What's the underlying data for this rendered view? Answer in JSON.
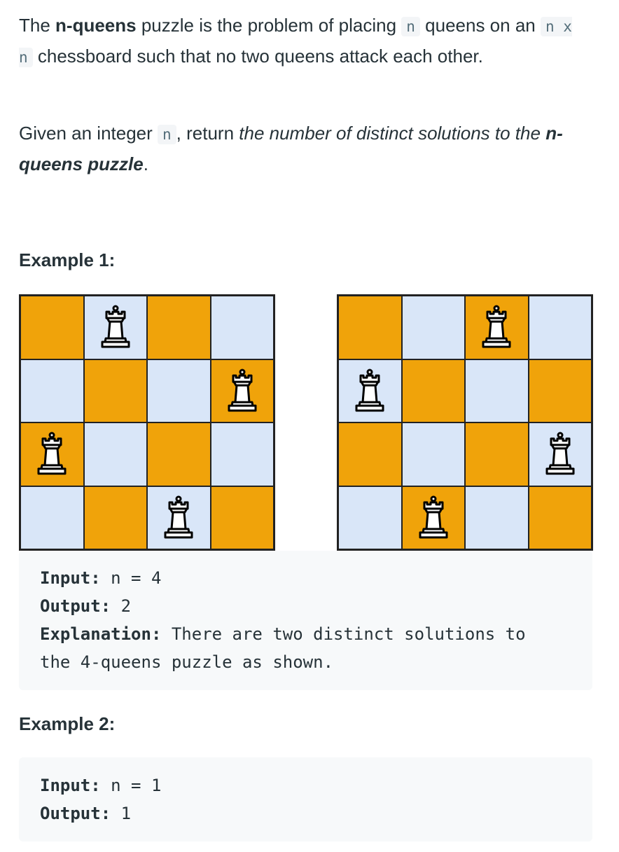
{
  "intro": {
    "t1": "The ",
    "b1": "n-queens",
    "t2": " puzzle is the problem of placing ",
    "c1": "n",
    "t3": " queens on an ",
    "c2": "n x n",
    "t4": " chessboard such that no two queens attack each other."
  },
  "task": {
    "t1": "Given an integer ",
    "c1": "n",
    "t2": ", return ",
    "i1": "the number of distinct solutions to the ",
    "bi1": "n-queens puzzle",
    "t3": "."
  },
  "example1": {
    "heading": "Example 1:",
    "boards": [
      {
        "queens": [
          1,
          3,
          0,
          2
        ]
      },
      {
        "queens": [
          2,
          0,
          3,
          1
        ]
      }
    ],
    "input_label": "Input:",
    "input_value": " n = 4",
    "output_label": "Output:",
    "output_value": " 2",
    "explanation_label": "Explanation:",
    "explanation_line1": " There are two distinct solutions to",
    "explanation_line2": "the 4-queens puzzle as shown."
  },
  "example2": {
    "heading": "Example 2:",
    "input_label": "Input:",
    "input_value": " n = 1",
    "output_label": "Output:",
    "output_value": " 1"
  },
  "colors": {
    "dark_square": "#f0a30a",
    "light_square": "#d9e6f8"
  },
  "icons": {
    "queen": "chess-queen-icon"
  }
}
